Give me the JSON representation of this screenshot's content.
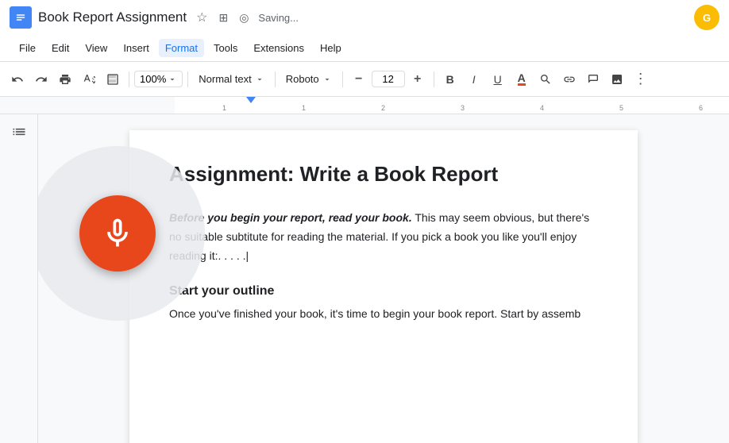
{
  "titleBar": {
    "docTitle": "Book Report Assignment",
    "savingText": "Saving...",
    "starIcon": "★",
    "driveIcon": "◼"
  },
  "menuBar": {
    "items": [
      "File",
      "Edit",
      "View",
      "Insert",
      "Format",
      "Tools",
      "Extensions",
      "Help"
    ],
    "activeItem": "Format"
  },
  "toolbar": {
    "zoomLevel": "100%",
    "paragraphStyle": "Normal text",
    "fontFamily": "Roboto",
    "fontSize": "12",
    "undoLabel": "↩",
    "redoLabel": "↪",
    "printLabel": "🖨",
    "spellLabel": "✓",
    "paintLabel": "♦",
    "boldLabel": "B",
    "italicLabel": "I",
    "underlineLabel": "U",
    "textColorLabel": "A",
    "highlightLabel": "✏",
    "linkLabel": "🔗",
    "commentLabel": "💬",
    "imageLabel": "🖼",
    "moreLabel": "≡"
  },
  "document": {
    "title": "Assignment: Write a Book Report",
    "para1BoldItalic": "Before you begin your report, read your book.",
    "para1Rest": " This may seem obvious, but there's no suitable subtitute for reading the material. If you pick a book you like you'll enjoy reading it:. . . . .|",
    "heading2": "Start your outline",
    "para2": "Once you've finished your book, it's time to begin your book report. Start by assemb"
  },
  "outline": {
    "icon": "≡"
  },
  "mic": {
    "label": "microphone"
  }
}
